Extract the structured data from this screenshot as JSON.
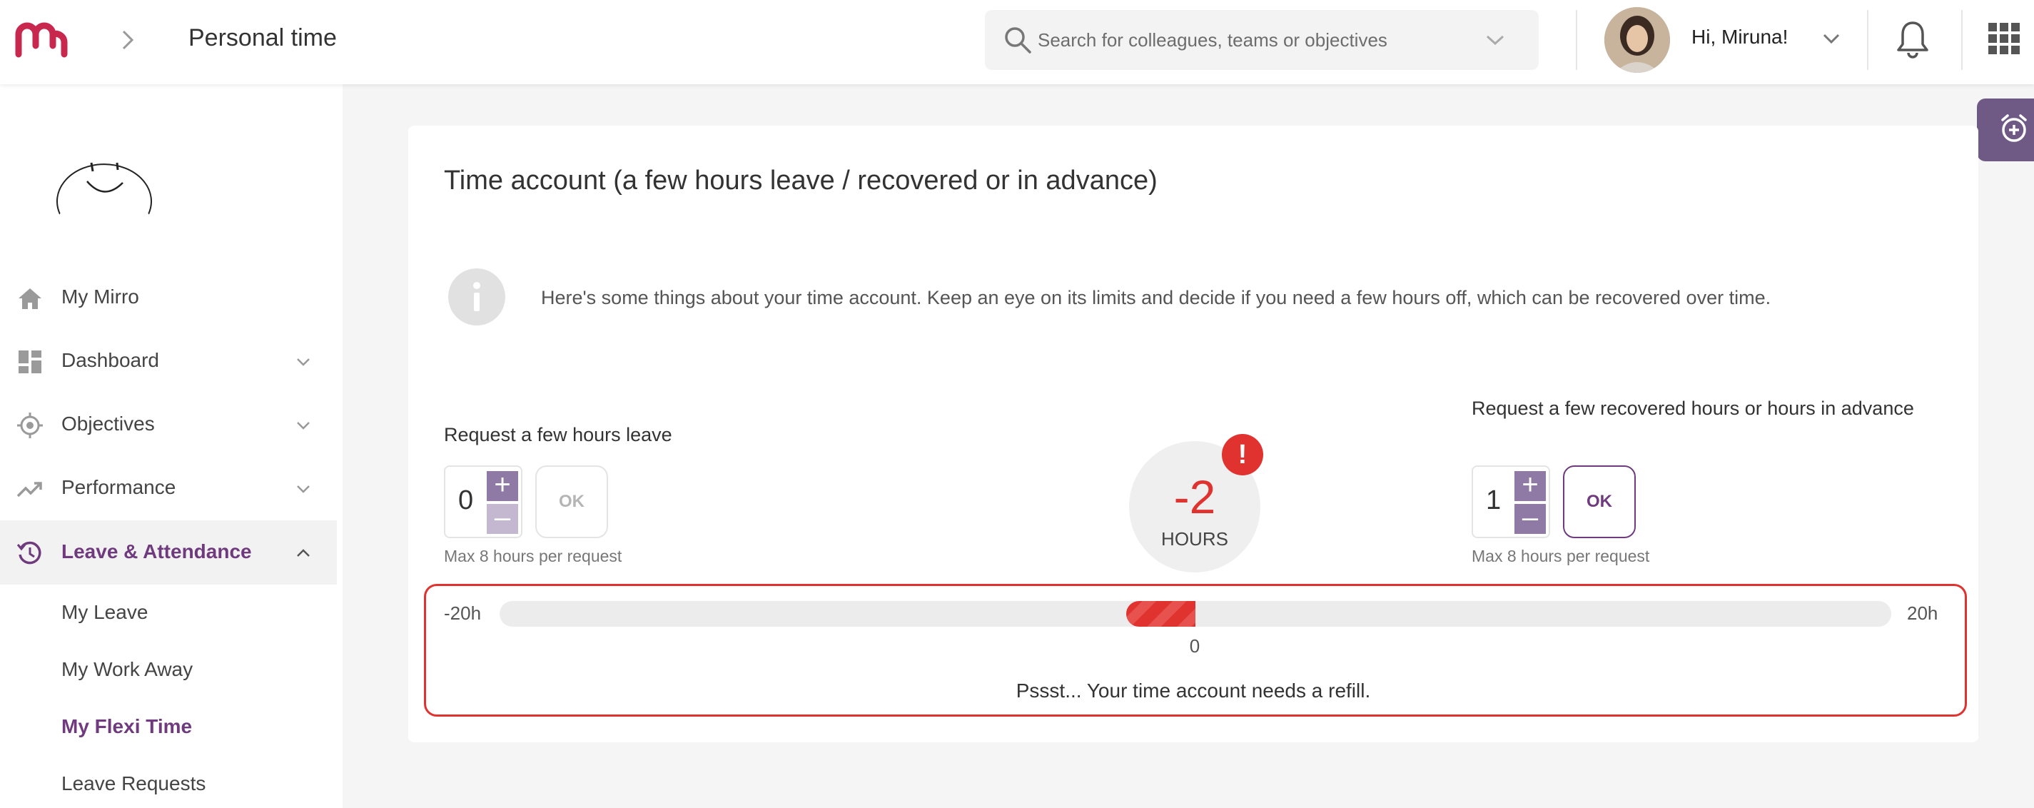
{
  "header": {
    "page_title": "Personal time",
    "search_placeholder": "Search for colleagues, teams or objectives",
    "greeting": "Hi, Miruna!"
  },
  "colors": {
    "brand": "#c8284d",
    "accent_purple": "#6f3b7e",
    "alert_red": "#e0332f",
    "stepper_active": "#8f7aa6",
    "stepper_disabled": "#c4b8d0"
  },
  "icons": {
    "logo": "mirro-logo-icon",
    "breadcrumb": "chevron-right-icon",
    "search": "search-icon",
    "notifications": "bell-icon",
    "apps": "apps-grid-icon",
    "float_tab": "alarm-clock-add-icon",
    "info": "info-icon"
  },
  "sidebar": {
    "items": [
      {
        "label": "My Mirro",
        "icon": "home-icon"
      },
      {
        "label": "Dashboard",
        "icon": "dashboard-icon"
      },
      {
        "label": "Objectives",
        "icon": "target-icon"
      },
      {
        "label": "Performance",
        "icon": "trending-up-icon"
      },
      {
        "label": "Leave & Attendance",
        "icon": "history-icon"
      }
    ],
    "sub_items": [
      {
        "label": "My Leave"
      },
      {
        "label": "My Work Away"
      },
      {
        "label": "My Flexi Time"
      },
      {
        "label": "Leave Requests"
      }
    ]
  },
  "card": {
    "title": "Time account (a few hours leave / recovered or in advance)",
    "info_text": "Here's some things about your time account. Keep an eye on its limits and decide if you need a few hours off, which can be recovered over time.",
    "left": {
      "label": "Request a few hours leave",
      "value": "0",
      "plus": "+",
      "minus": "–",
      "ok": "OK",
      "hint": "Max 8 hours per request"
    },
    "balance": {
      "value": "-2",
      "unit": "HOURS",
      "alert": "!"
    },
    "right": {
      "label": "Request a few recovered hours or hours in advance",
      "value": "1",
      "plus": "+",
      "minus": "–",
      "ok": "OK",
      "hint": "Max 8 hours per request"
    },
    "range": {
      "min_label": "-20h",
      "max_label": "20h",
      "zero_label": "0",
      "min": -20,
      "max": 20,
      "current": -2,
      "message": "Pssst... Your time account needs a refill."
    }
  }
}
